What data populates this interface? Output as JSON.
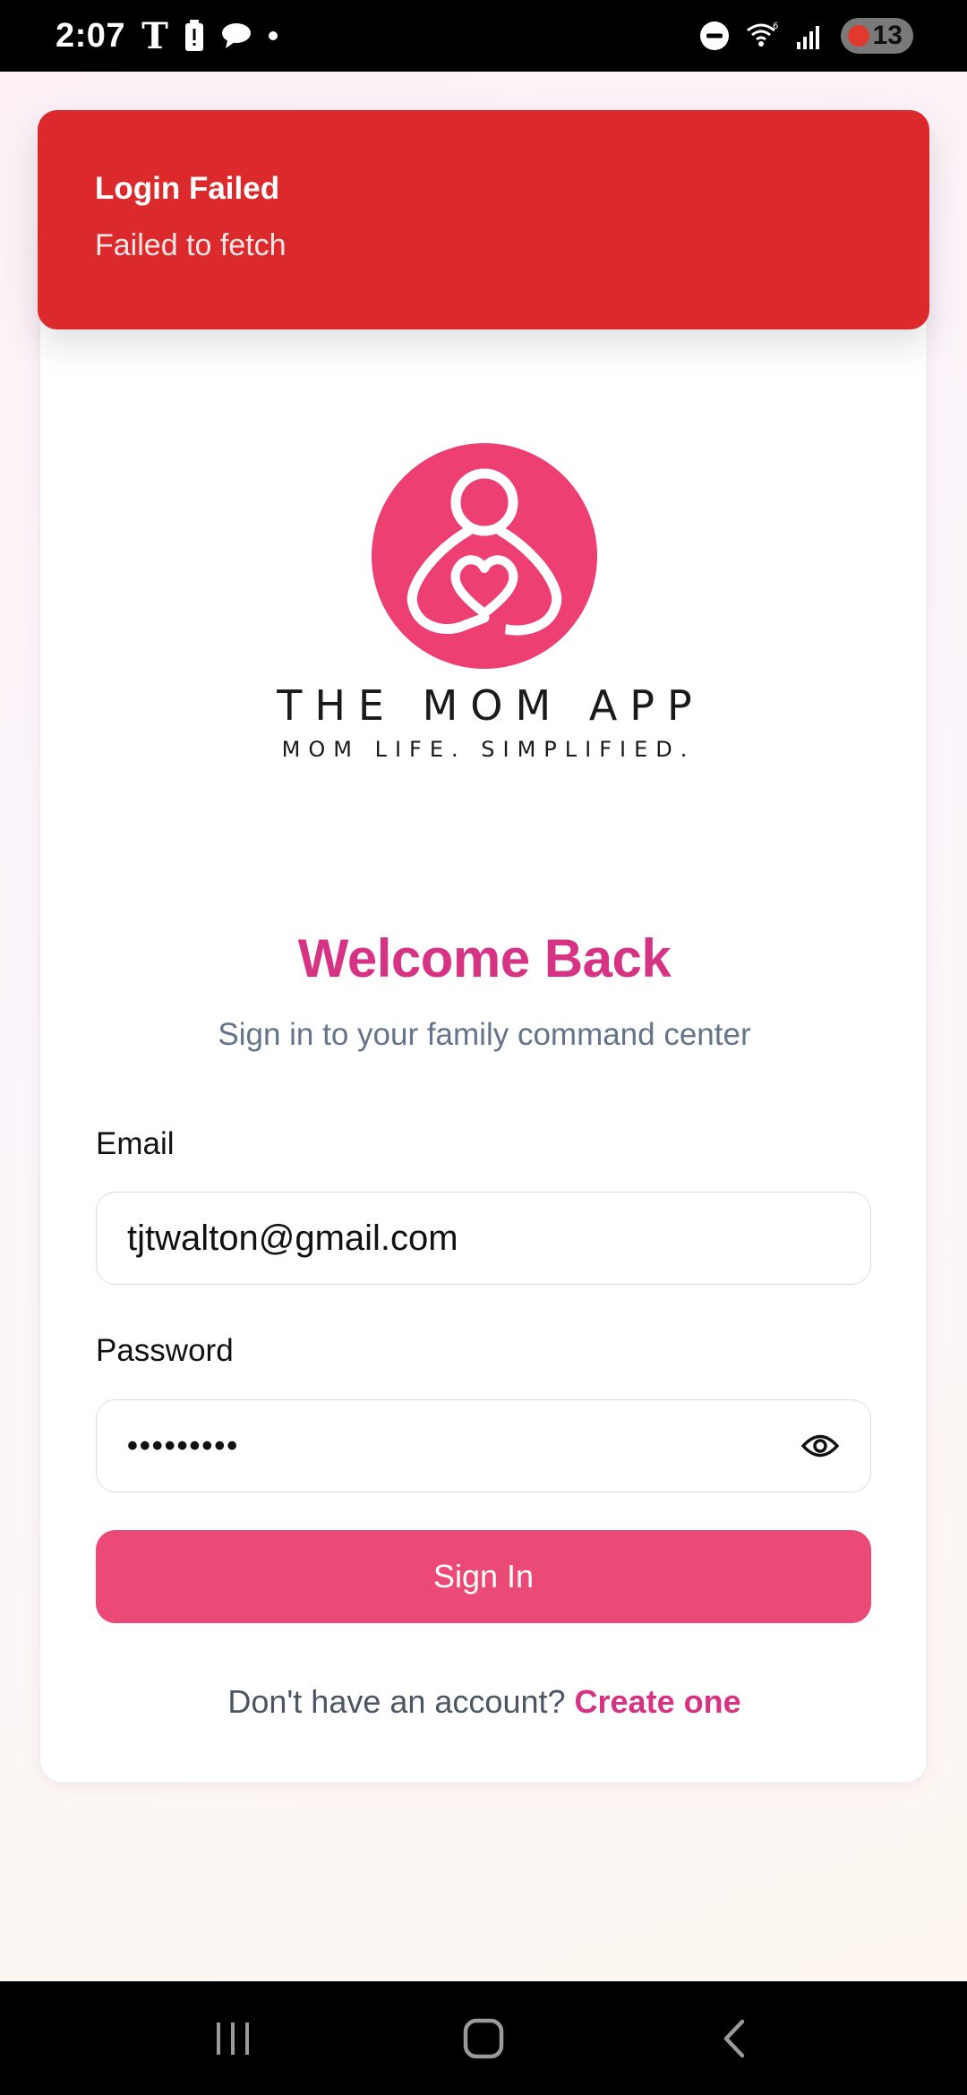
{
  "status_bar": {
    "time": "2:07",
    "carrier_icon": "T",
    "battery_level": "13",
    "icons": [
      "tmobile-icon",
      "battery-alert-icon",
      "chat-icon",
      "dot-icon",
      "dnd-icon",
      "wifi-icon",
      "signal-icon",
      "battery-icon"
    ]
  },
  "toast": {
    "title": "Login Failed",
    "message": "Failed to fetch",
    "color": "#dc2a2c"
  },
  "logo": {
    "title": "THE MOM APP",
    "tagline": "MOM LIFE. SIMPLIFIED.",
    "color": "#ee3f73"
  },
  "login": {
    "heading": "Welcome Back",
    "subtitle": "Sign in to your family command center",
    "email_label": "Email",
    "email_value": "tjtwalton@gmail.com",
    "password_label": "Password",
    "password_value": "•••••••••",
    "sign_in_label": "Sign In",
    "footer_text": "Don't have an account?",
    "footer_link": "Create one",
    "accent_color": "#d63384",
    "button_color": "#ec4a76"
  },
  "nav_bar": {
    "buttons": [
      "recents-icon",
      "home-icon",
      "back-icon"
    ]
  }
}
